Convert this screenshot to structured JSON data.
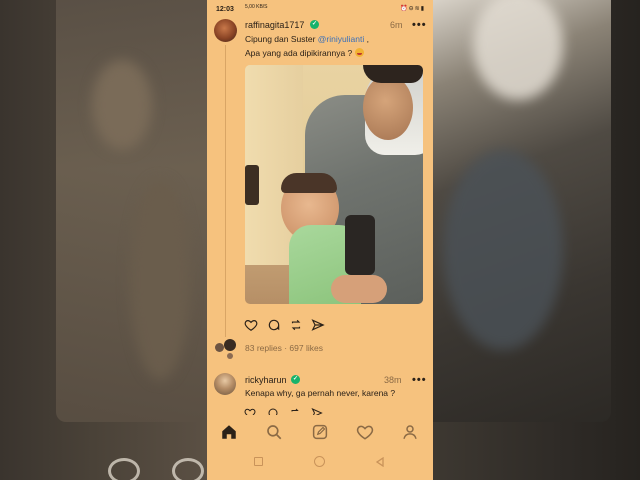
{
  "status_bar": {
    "time": "12:03",
    "network": "5,00 KB/S",
    "icons": [
      "wifi-icon",
      "alarm-icon",
      "do-not-disturb-icon",
      "bluetooth-icon",
      "battery-icon"
    ]
  },
  "post": {
    "username": "raffinagita1717",
    "verified": true,
    "time": "6m",
    "more": "•••",
    "line1_prefix": "Cipung dan Suster ",
    "mention": "@riniyulianti",
    "line1_suffix": " ,",
    "line2": "Apa yang ada dipikirannya ? ",
    "emoji": "smiling-face-emoji",
    "stats": "83 replies · 697 likes",
    "actions": [
      "heart-icon",
      "comment-icon",
      "repost-icon",
      "share-icon"
    ]
  },
  "reply": {
    "username": "rickyharun",
    "verified": true,
    "time": "38m",
    "more": "•••",
    "text": "Kenapa why, ga pernah never, karena ?"
  },
  "bottom_nav": [
    "home-icon",
    "search-icon",
    "compose-icon",
    "activity-heart-icon",
    "profile-icon"
  ],
  "system_nav": [
    "recents-square-icon",
    "home-circle-icon",
    "back-triangle-icon"
  ],
  "colors": {
    "phone_background": "#f6c27e",
    "verified": "#18b36b",
    "mention": "#3a6fb8",
    "muted_text": "#8b6a45"
  }
}
